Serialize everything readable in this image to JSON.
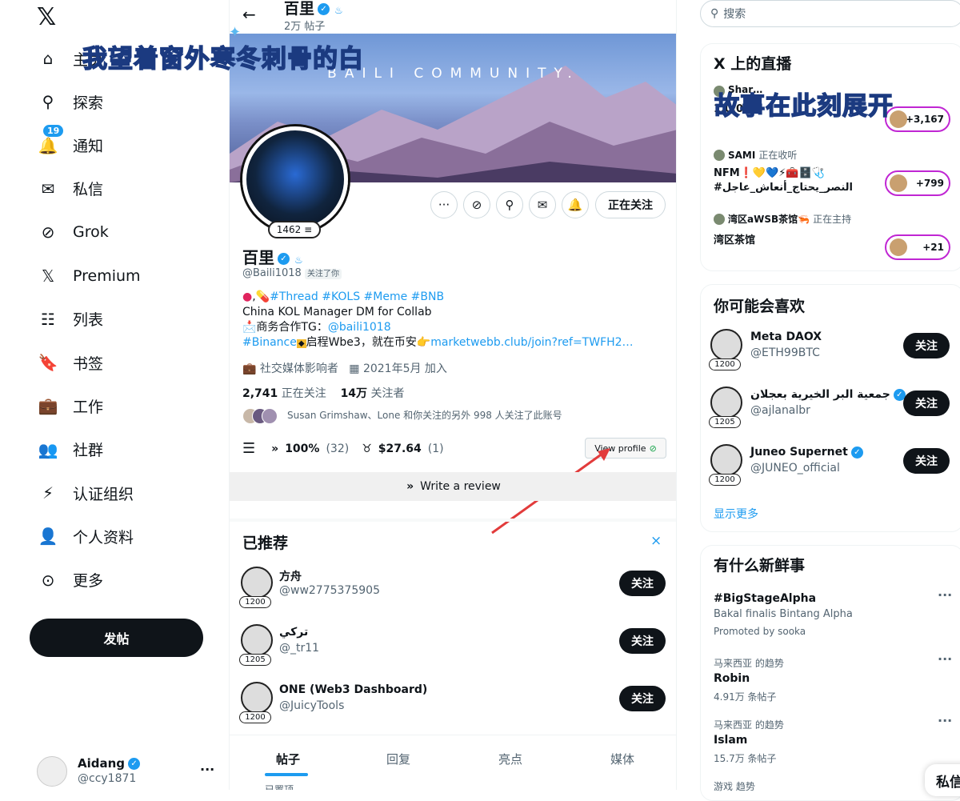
{
  "nav": {
    "items": [
      {
        "label": "主页",
        "icon": "home-icon"
      },
      {
        "label": "探索",
        "icon": "search-icon"
      },
      {
        "label": "通知",
        "icon": "bell-icon",
        "badge": "19"
      },
      {
        "label": "私信",
        "icon": "mail-icon"
      },
      {
        "label": "Grok",
        "icon": "grok-icon"
      },
      {
        "label": "Premium",
        "icon": "x-logo-icon"
      },
      {
        "label": "列表",
        "icon": "list-icon"
      },
      {
        "label": "书签",
        "icon": "bookmark-icon"
      },
      {
        "label": "工作",
        "icon": "briefcase-icon"
      },
      {
        "label": "社群",
        "icon": "community-icon"
      },
      {
        "label": "认证组织",
        "icon": "lightning-icon"
      },
      {
        "label": "个人资料",
        "icon": "person-icon"
      },
      {
        "label": "更多",
        "icon": "more-circle-icon"
      }
    ],
    "post_label": "发帖",
    "account": {
      "name": "Aidang",
      "handle": "@ccy1871"
    }
  },
  "overlay": {
    "text1": "我望着窗外寒冬刺骨的白",
    "text2": "故事在此刻展开"
  },
  "profile": {
    "header_name": "百里",
    "header_posts": "2万 帖子",
    "banner_text": "BAILI COMMUNITY.",
    "k_score": "1462",
    "name": "百里",
    "handle": "@Baili1018",
    "follows_you": "关注了你",
    "following_button": "正在关注",
    "bio": {
      "line1_tags": "#Thread #KOLS  #Meme  #BNB",
      "line2": "China KOL Manager DM for Collab",
      "line3_prefix": "📩商务合作TG：",
      "line3_link": "@baili1018",
      "line4_tag": "#Binance",
      "line4_text": "启程Wbe3，就在币安👉",
      "line4_link": "marketwebb.club/join?ref=TWFH2…"
    },
    "category": "社交媒体影响者",
    "joined": "2021年5月 加入",
    "following_count": "2,741",
    "following_label": "正在关注",
    "followers_count": "14万",
    "followers_label": "关注者",
    "followed_by": "Susan Grimshaw、Lone 和你关注的另外 998 人关注了此账号",
    "stats": {
      "percent": "100%",
      "percent_count": "(32)",
      "amount": "$27.64",
      "amount_count": "(1)"
    },
    "view_profile": "View profile",
    "write_review": "Write a review"
  },
  "recommended": {
    "title": "已推荐",
    "items": [
      {
        "name": "方舟",
        "handle": "@ww2775375905",
        "k": "1200",
        "follow": "关注"
      },
      {
        "name": "تركي",
        "handle": "@_tr11",
        "k": "1205",
        "follow": "关注"
      },
      {
        "name": "ONE (Web3 Dashboard)",
        "handle": "@JuicyTools",
        "k": "1200",
        "follow": "关注"
      }
    ]
  },
  "tabs": [
    "帖子",
    "回复",
    "亮点",
    "媒体"
  ],
  "pinned_partial": "已置顶",
  "right": {
    "search_placeholder": "搜索",
    "live": {
      "title": "X 上的直播",
      "items": [
        {
          "host": "Shar…",
          "status": "",
          "title": "1.0.0",
          "count": "+3,167"
        },
        {
          "host": "SAMI",
          "status": "正在收听",
          "title": "NFM❗💛💙⚡🧰🗄️🩺",
          "subtitle": "#النصر_يحتاج_أنعاش_عاجل",
          "count": "+799"
        },
        {
          "host": "湾区aWSB茶馆🦐",
          "status": "正在主持",
          "title": "湾区茶馆",
          "count": "+21"
        }
      ]
    },
    "suggest": {
      "title": "你可能会喜欢",
      "items": [
        {
          "name": "Meta DAOX",
          "handle": "@ETH99BTC",
          "k": "1200",
          "follow": "关注"
        },
        {
          "name": "جمعية البر الخيرية بعجلان",
          "handle": "@ajlanalbr",
          "k": "1205",
          "follow": "关注"
        },
        {
          "name": "Juneo Supernet",
          "handle": "@JUNEO_official",
          "k": "1200",
          "follow": "关注"
        }
      ],
      "show_more": "显示更多"
    },
    "trends": {
      "title": "有什么新鲜事",
      "items": [
        {
          "top": "#BigStageAlpha",
          "mid": "Bakal finalis Bintang Alpha",
          "bottom": "Promoted by sooka"
        },
        {
          "top": "马来西亚 的趋势",
          "mid": "Robin",
          "bottom": "4.91万 条帖子"
        },
        {
          "top": "马来西亚 的趋势",
          "mid": "Islam",
          "bottom": "15.7万 条帖子"
        },
        {
          "top": "游戏 趋势",
          "mid": "",
          "bottom": ""
        }
      ]
    },
    "dm_partial": "私信"
  }
}
